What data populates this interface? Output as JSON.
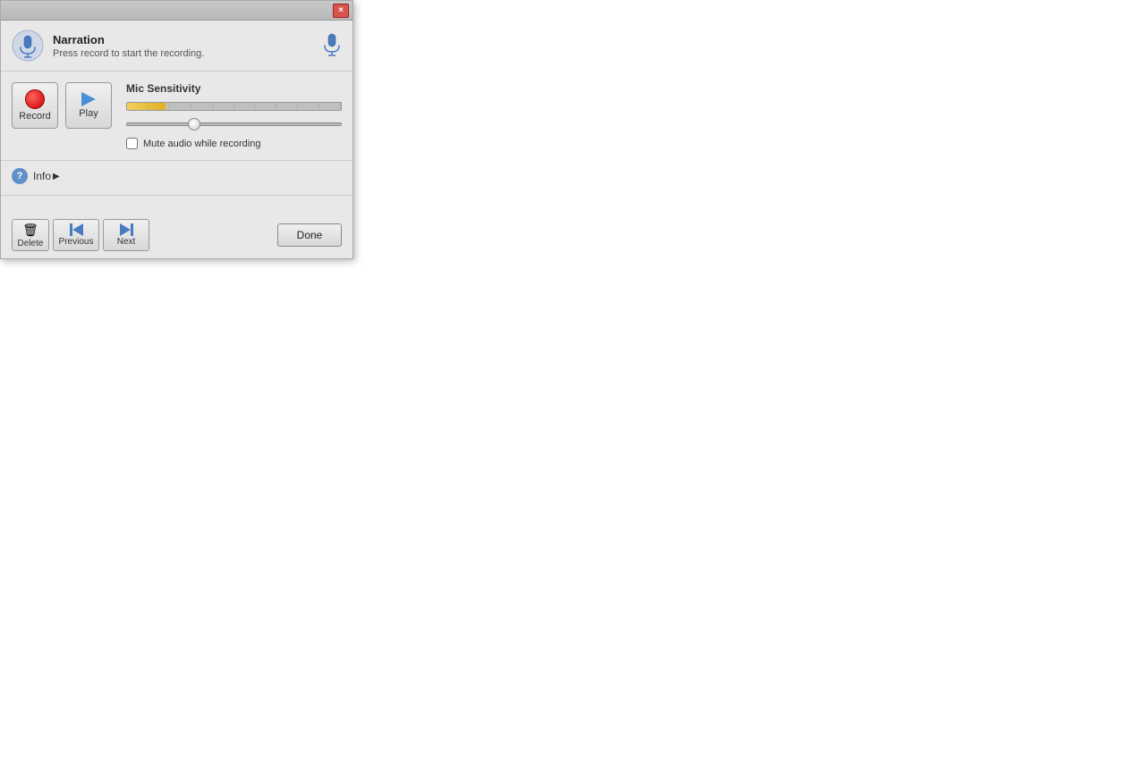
{
  "dialog": {
    "title": "Narration",
    "header_title": "Narration",
    "header_subtitle": "Press record to start the recording.",
    "close_label": "×"
  },
  "controls": {
    "record_label": "Record",
    "play_label": "Play",
    "mic_sensitivity_label": "Mic Sensitivity",
    "mute_label": "Mute audio while recording",
    "slider_value": "30"
  },
  "info": {
    "label": "Info",
    "arrow": "▶"
  },
  "footer": {
    "delete_label": "Delete",
    "previous_label": "Previous",
    "next_label": "Next",
    "done_label": "Done"
  }
}
